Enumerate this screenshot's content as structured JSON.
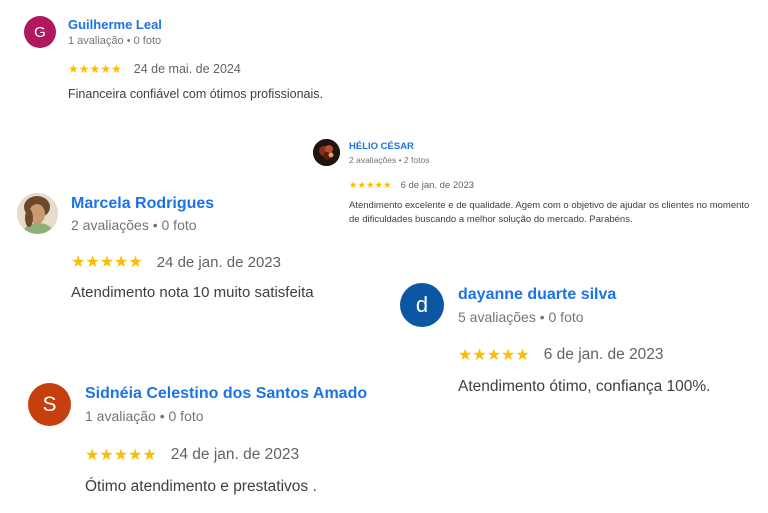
{
  "reviews": [
    {
      "avatar_letter": "G",
      "name": "Guilherme Leal",
      "meta": "1 avaliação • 0 foto",
      "stars": "★★★★★",
      "date": "24 de mai. de 2024",
      "text": "Financeira confiável com ótimos profissionais."
    },
    {
      "avatar_letter": "",
      "name": "HÉLIO CÉSAR",
      "meta": "2 avaliações • 2 fotos",
      "stars": "★★★★★",
      "date": "6 de jan. de 2023",
      "text": "Atendimento excelente e de qualidade. Agem com o objetivo de ajudar os clientes no momento de dificuldades buscando a melhor solução do mercado. Parabéns."
    },
    {
      "avatar_letter": "",
      "name": "Marcela Rodrigues",
      "meta": "2 avaliações • 0 foto",
      "stars": "★★★★★",
      "date": "24 de jan. de 2023",
      "text": "Atendimento nota 10 muito satisfeita"
    },
    {
      "avatar_letter": "d",
      "name": "dayanne duarte silva",
      "meta": "5 avaliações • 0 foto",
      "stars": "★★★★★",
      "date": "6 de jan. de 2023",
      "text": "Atendimento ótimo, confiança 100%."
    },
    {
      "avatar_letter": "S",
      "name": "Sidnéia Celestino dos Santos Amado",
      "meta": "1 avaliação • 0 foto",
      "stars": "★★★★★",
      "date": "24 de jan. de 2023",
      "text": "Ótimo atendimento e prestativos ."
    }
  ],
  "colors": {
    "name_link": "#1a73e8",
    "star": "#fbbc04",
    "meta": "#70757a",
    "text": "#3c4043"
  }
}
